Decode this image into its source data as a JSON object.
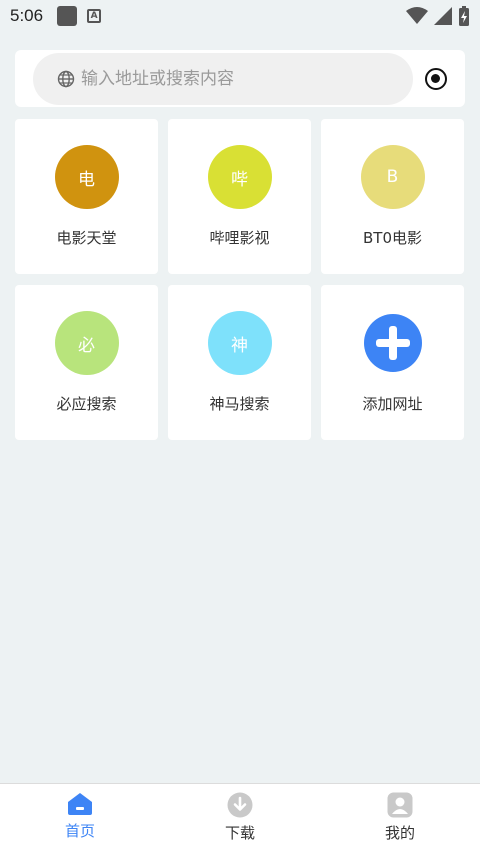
{
  "status_bar": {
    "time": "5:06"
  },
  "search": {
    "placeholder": "输入地址或搜索内容"
  },
  "tiles": [
    {
      "label": "电影天堂",
      "initial": "电",
      "color": "#d0930f"
    },
    {
      "label": "哔哩影视",
      "initial": "哔",
      "color": "#d9e034"
    },
    {
      "label": "BT0电影",
      "initial": "B",
      "color": "#e7dc7a"
    },
    {
      "label": "必应搜索",
      "initial": "必",
      "color": "#b8e47c"
    },
    {
      "label": "神马搜索",
      "initial": "神",
      "color": "#7ee1fb"
    },
    {
      "label": "添加网址",
      "icon": "plus-circle-icon",
      "color": "#3d84f5"
    }
  ],
  "bottom_nav": {
    "items": [
      {
        "label": "首页",
        "icon": "home-icon",
        "active": true
      },
      {
        "label": "下载",
        "icon": "download-icon",
        "active": false
      },
      {
        "label": "我的",
        "icon": "user-icon",
        "active": false
      }
    ]
  },
  "colors": {
    "accent": "#3d84f5",
    "background": "#edf2f3"
  }
}
